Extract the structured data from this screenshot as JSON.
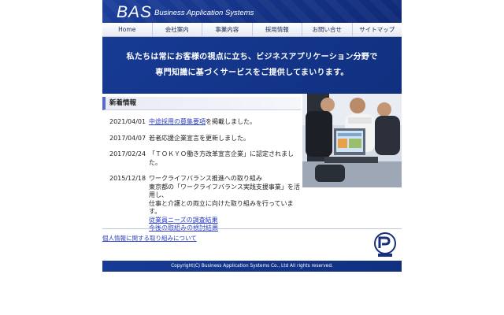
{
  "header": {
    "logo": "BAS",
    "tagline": "Business Application Systems"
  },
  "nav": {
    "items": [
      "Home",
      "会社案内",
      "事業内容",
      "採用情報",
      "お問い合せ",
      "サイトマップ"
    ]
  },
  "banner": {
    "line1": "私たちは常にお客様の視点に立ち、ビジネスアプリケーション分野で",
    "line2": "専門知識に基づくサービスをご提供してまいります。"
  },
  "news": {
    "title": "新着情報",
    "items": [
      {
        "date": "2021/04/01",
        "link": "中途採用の募集要項",
        "text": "を掲載しました。"
      },
      {
        "date": "2017/04/07",
        "text": "若者応援企業宣言を更新しました。"
      },
      {
        "date": "2017/02/24",
        "text": "「ＴＯＫＹＯ働き方改革宣言企業」に認定されました。"
      },
      {
        "date": "2015/12/18",
        "lines": [
          "ワークライフバランス推進への取り組み",
          "東京都の「ワークライフバランス実践支援事業」を活用し、",
          "仕事と介護との両立に向けた取り組みを行っています。"
        ],
        "link1": "従業員ニーズの調査結果",
        "link2": "今後の取組みの検討結果"
      }
    ]
  },
  "privacy_link": "個人情報に関する取り組みについて",
  "footer": "Copyright(C) Business Application Systems Co., Ltd All rights reserved.",
  "colors": {
    "brand_blue": "#143285",
    "link": "#2b3fc0",
    "accent_bar": "#5b6ac8"
  }
}
